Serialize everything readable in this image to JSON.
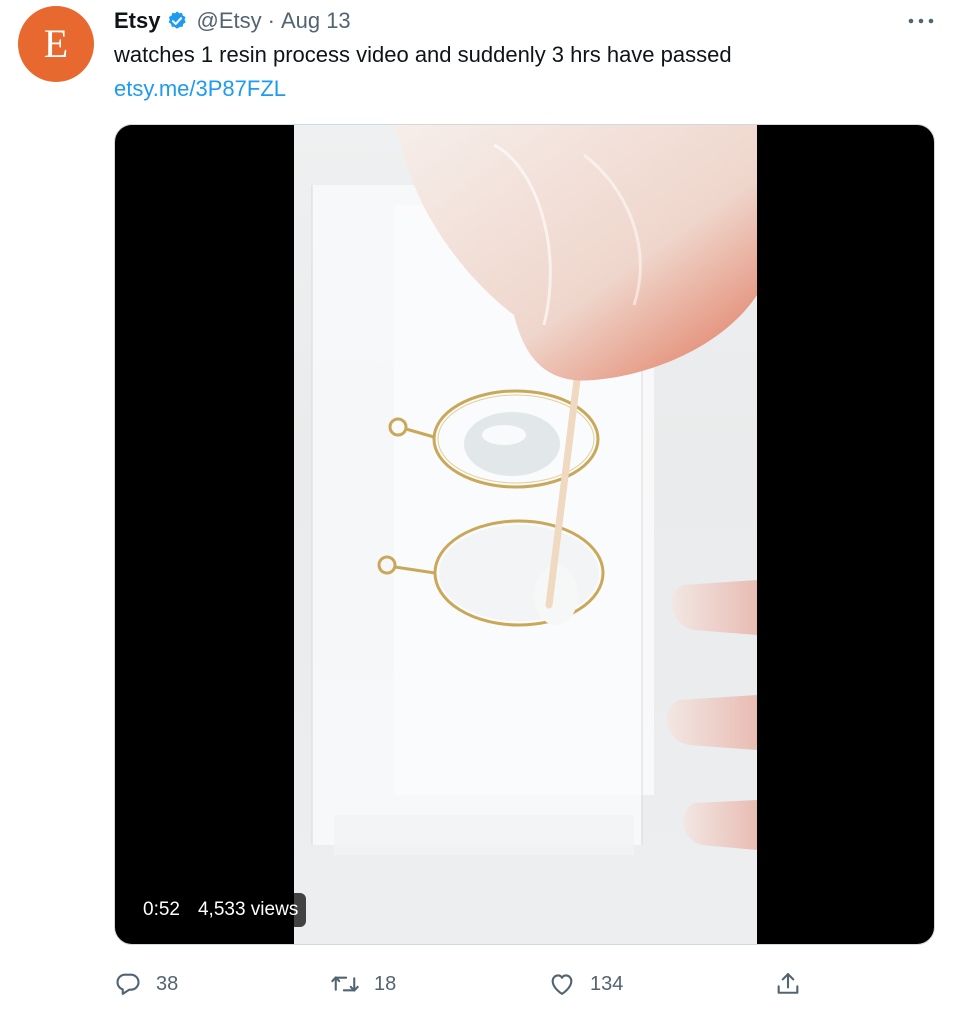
{
  "author": {
    "avatar_letter": "E",
    "avatar_color": "#e8692f",
    "name": "Etsy",
    "verified_icon": "verified-badge-icon",
    "handle": "@Etsy",
    "separator": "·",
    "date": "Aug 13"
  },
  "tweet": {
    "text": "watches 1 resin process video and suddenly 3 hrs have passed",
    "link": "etsy.me/3P87FZL"
  },
  "video": {
    "duration": "0:52",
    "views": "4,533 views"
  },
  "actions": {
    "reply_count": "38",
    "retweet_count": "18",
    "like_count": "134"
  },
  "colors": {
    "link": "#1d9bf0",
    "secondary_text": "#536471",
    "verified": "#1d9bf0"
  }
}
